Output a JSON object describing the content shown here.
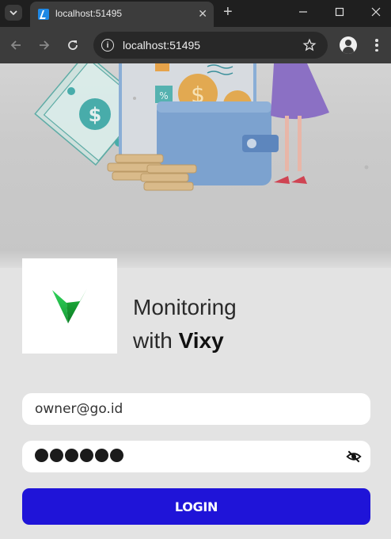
{
  "browser": {
    "tab_title": "localhost:51495",
    "url": "localhost:51495",
    "new_tab_symbol": "+",
    "close_tab_symbol": "✕"
  },
  "brand": {
    "line1": "Monitoring",
    "line2_prefix": "with",
    "line2_name": "Vixy",
    "logo_icon": "vixy-v-logo"
  },
  "form": {
    "email_value": "owner@go.id",
    "password_mask_count": 6,
    "password_visibility_icon": "eye-off-icon",
    "login_label": "LOGIN"
  },
  "colors": {
    "login_button": "#1f14d8",
    "logo_green": "#1db954"
  }
}
